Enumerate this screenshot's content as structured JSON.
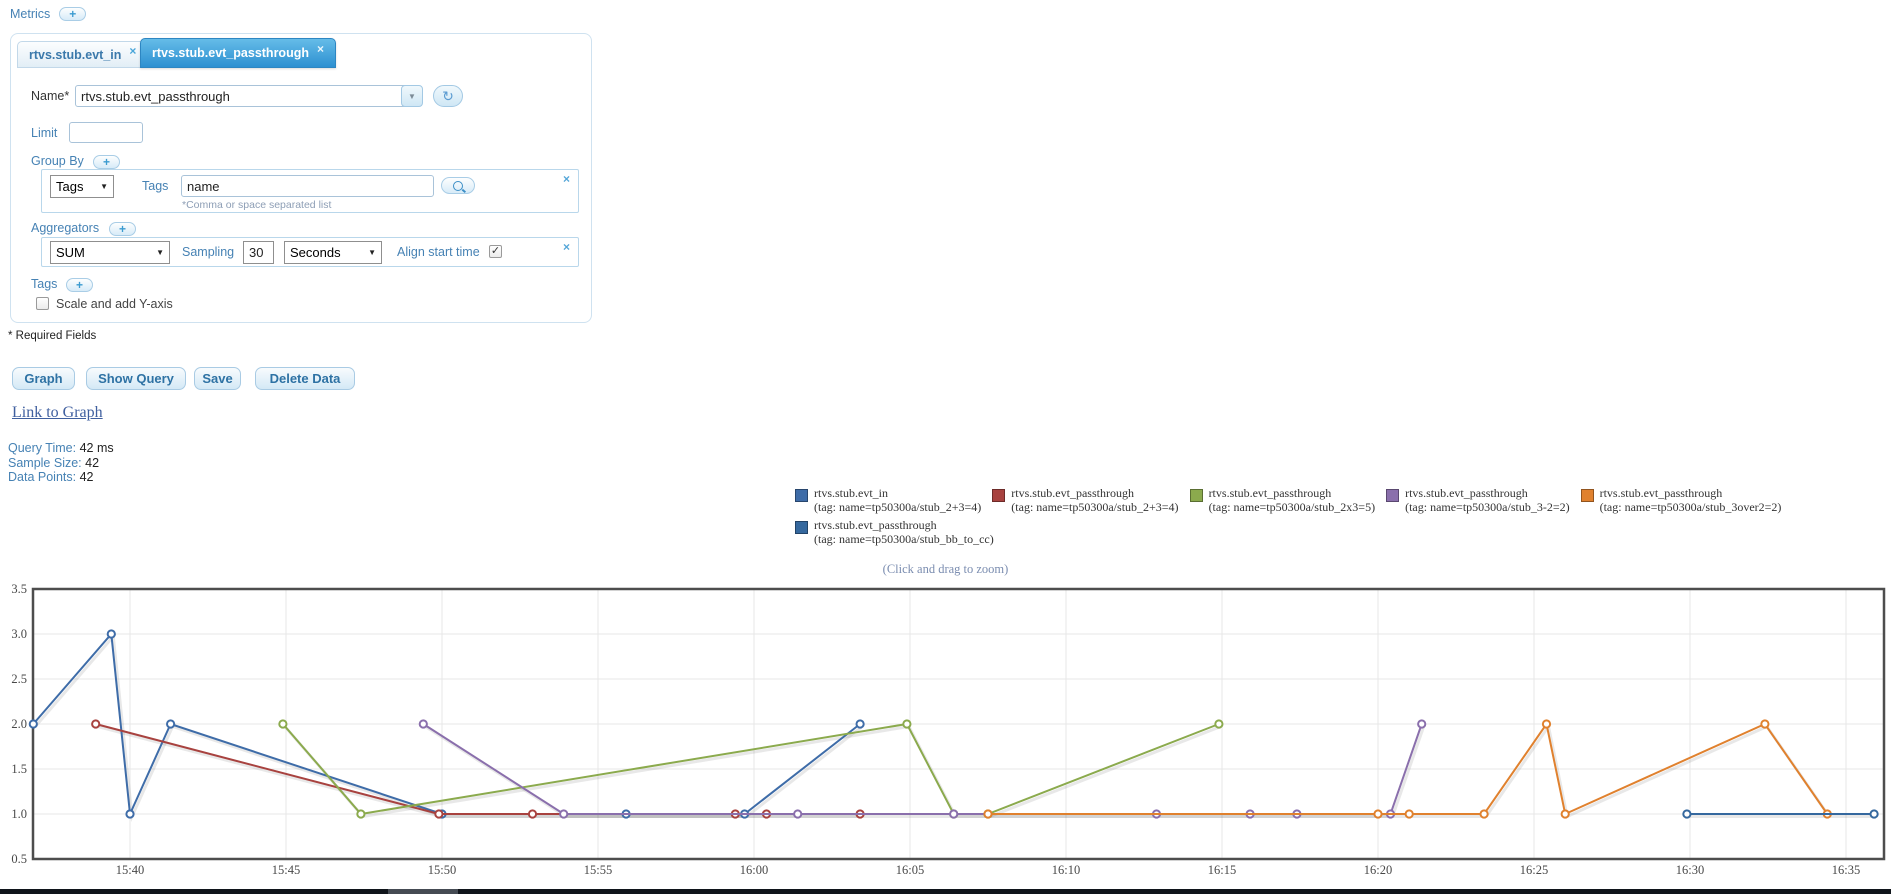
{
  "metrics": {
    "label": "Metrics",
    "add": "+"
  },
  "icons": {
    "select_arrow": "▼",
    "combo_arrow": "▼",
    "refresh": "↻",
    "checkmark": "✓"
  },
  "tabs": [
    {
      "label": "rtvs.stub.evt_in",
      "close": "×",
      "active": false
    },
    {
      "label": "rtvs.stub.evt_passthrough",
      "close": "×",
      "active": true
    }
  ],
  "form": {
    "name": {
      "label": "Name*",
      "value": "rtvs.stub.evt_passthrough"
    },
    "limit": {
      "label": "Limit",
      "value": ""
    },
    "group_by": {
      "label": "Group By",
      "add": "+",
      "type_value": "Tags",
      "tags_label": "Tags",
      "tags_value": "name",
      "hint": "*Comma or space separated list",
      "remove": "×"
    },
    "aggregators": {
      "label": "Aggregators",
      "add": "+",
      "fn_value": "SUM",
      "sampling_label": "Sampling",
      "sampling_value": "30",
      "unit_value": "Seconds",
      "align_label": "Align start time",
      "align_checked": true,
      "remove": "×"
    },
    "tags": {
      "label": "Tags",
      "add": "+"
    },
    "scale": {
      "label": "Scale and add Y-axis",
      "checked": false
    },
    "required_note": "* Required Fields"
  },
  "actions": {
    "graph": "Graph",
    "show_query": "Show Query",
    "save": "Save",
    "delete_data": "Delete Data"
  },
  "link_to_graph": "Link to Graph",
  "stats": [
    {
      "label": "Query Time:",
      "value": "42 ms"
    },
    {
      "label": "Sample Size:",
      "value": "42"
    },
    {
      "label": "Data Points:",
      "value": "42"
    }
  ],
  "zoom_hint": "(Click and drag to zoom)",
  "chart_data": {
    "type": "line",
    "title": "",
    "grid": true,
    "legend_position": "top-center",
    "marker": "open-circle",
    "x_axis": {
      "unit": "minutes relative to 15:40",
      "tick_minutes": [
        0,
        5,
        10,
        15,
        20,
        25,
        30,
        35,
        40,
        45,
        50,
        55
      ],
      "tick_labels": [
        "15:40",
        "15:45",
        "15:50",
        "15:55",
        "16:00",
        "16:05",
        "16:10",
        "16:15",
        "16:20",
        "16:25",
        "16:30",
        "16:35"
      ]
    },
    "y_axis": {
      "min": 0.5,
      "max": 3.5,
      "ticks": [
        0.5,
        1.0,
        1.5,
        2.0,
        2.5,
        3.0,
        3.5
      ]
    },
    "series": [
      {
        "name": "rtvs.stub.evt_in",
        "tag": "(tag: name=tp50300a/stub_2+3=4)",
        "color": "#3e6ca8",
        "points": [
          [
            -3.1,
            2
          ],
          [
            -0.6,
            3
          ],
          [
            0,
            1
          ],
          [
            1.3,
            2
          ],
          [
            10,
            1
          ],
          [
            15.9,
            1
          ],
          [
            19.7,
            1
          ],
          [
            23.4,
            2
          ]
        ]
      },
      {
        "name": "rtvs.stub.evt_passthrough",
        "tag": "(tag: name=tp50300a/stub_2+3=4)",
        "color": "#a8423f",
        "points": [
          [
            -1.1,
            2
          ],
          [
            9.9,
            1
          ],
          [
            12.9,
            1
          ],
          [
            19.4,
            1
          ],
          [
            20.4,
            1
          ],
          [
            23.4,
            1
          ]
        ]
      },
      {
        "name": "rtvs.stub.evt_passthrough",
        "tag": "(tag: name=tp50300a/stub_2x3=5)",
        "color": "#8baa4d",
        "points": [
          [
            4.9,
            2
          ],
          [
            7.4,
            1
          ],
          [
            24.9,
            2
          ],
          [
            26.4,
            1
          ],
          [
            27.5,
            1
          ],
          [
            34.9,
            2
          ]
        ]
      },
      {
        "name": "rtvs.stub.evt_passthrough",
        "tag": "(tag: name=tp50300a/stub_3-2=2)",
        "color": "#8a6fac",
        "points": [
          [
            9.4,
            2
          ],
          [
            13.9,
            1
          ],
          [
            21.4,
            1
          ],
          [
            26.4,
            1
          ],
          [
            32.9,
            1
          ],
          [
            35.9,
            1
          ],
          [
            37.4,
            1
          ],
          [
            40.4,
            1
          ],
          [
            41.4,
            2
          ]
        ]
      },
      {
        "name": "rtvs.stub.evt_passthrough",
        "tag": "(tag: name=tp50300a/stub_3over2=2)",
        "color": "#e0812e",
        "points": [
          [
            27.5,
            1
          ],
          [
            40.0,
            1
          ],
          [
            41.0,
            1
          ],
          [
            43.4,
            1
          ],
          [
            45.4,
            2
          ],
          [
            46.0,
            1
          ],
          [
            52.4,
            2
          ],
          [
            54.4,
            1
          ]
        ]
      },
      {
        "name": "rtvs.stub.evt_passthrough",
        "tag": "(tag: name=tp50300a/stub_bb_to_cc)",
        "color": "#35689e",
        "points": [
          [
            49.9,
            1
          ],
          [
            55.9,
            1
          ]
        ]
      }
    ]
  }
}
